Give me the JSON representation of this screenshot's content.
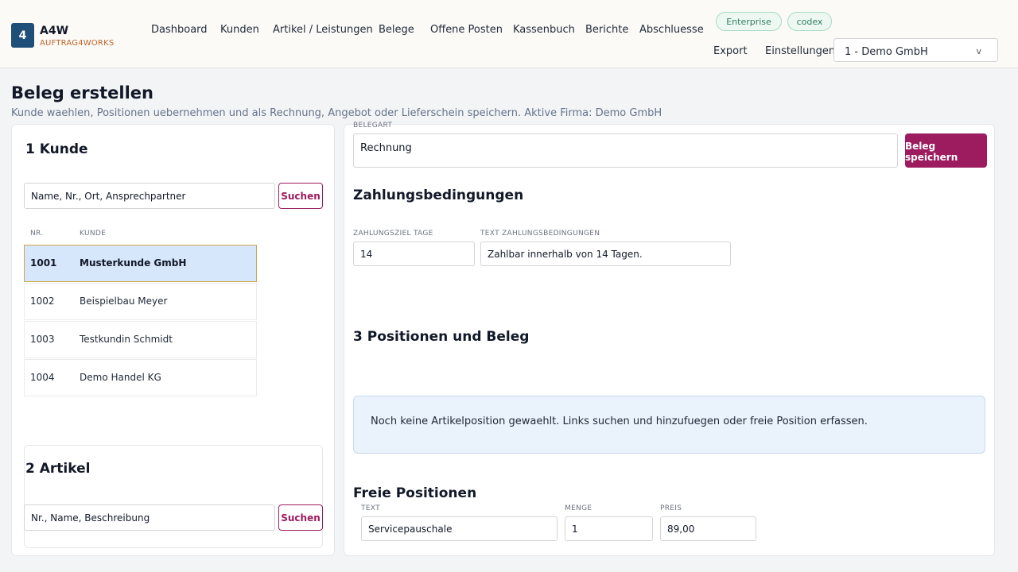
{
  "brand": {
    "logo_char": "4",
    "name": "A4W",
    "subtitle": "AUFTRAG4WORKS"
  },
  "nav": {
    "items": [
      "Dashboard",
      "Kunden",
      "Artikel / Leistungen",
      "Belege",
      "Offene Posten",
      "Kassenbuch",
      "Berichte",
      "Abschluesse"
    ],
    "badges": [
      "Enterprise",
      "codex"
    ],
    "export": "Export",
    "settings": "Einstellungen",
    "company": "1 - Demo GmbH",
    "company_chevron": "v"
  },
  "page": {
    "title": "Beleg erstellen",
    "subtitle": "Kunde waehlen, Positionen uebernehmen und als Rechnung, Angebot oder Lieferschein speichern. Aktive Firma: Demo GmbH"
  },
  "kunde": {
    "heading": "1  Kunde",
    "search_placeholder": "Name, Nr., Ort, Ansprechpartner",
    "search_button": "Suchen",
    "col_nr": "NR.",
    "col_kunde": "KUNDE",
    "rows": [
      {
        "nr": "1001",
        "name": "Musterkunde GmbH",
        "selected": true
      },
      {
        "nr": "1002",
        "name": "Beispielbau Meyer",
        "selected": false
      },
      {
        "nr": "1003",
        "name": "Testkundin Schmidt",
        "selected": false
      },
      {
        "nr": "1004",
        "name": "Demo Handel KG",
        "selected": false
      }
    ]
  },
  "artikel": {
    "heading": "2  Artikel",
    "search_placeholder": "Nr., Name, Beschreibung",
    "search_button": "Suchen"
  },
  "beleg": {
    "belegart_label": "BELEGART",
    "belegart_value": "Rechnung",
    "save_button": "Beleg speichern",
    "zahlung_heading": "Zahlungsbedingungen",
    "ziel_label": "ZAHLUNGSZIEL TAGE",
    "ziel_value": "14",
    "text_label": "TEXT ZAHLUNGSBEDINGUNGEN",
    "text_value": "Zahlbar innerhalb von 14 Tagen.",
    "positionen_heading": "3  Positionen und Beleg",
    "notice": "Noch keine Artikelposition gewaehlt. Links suchen und hinzufuegen oder freie Position erfassen.",
    "freie_heading": "Freie Positionen",
    "freie_text_label": "TEXT",
    "freie_text_value": "Servicepauschale",
    "menge_label": "MENGE",
    "menge_value": "1",
    "preis_label": "PREIS",
    "preis_value": "89,00"
  },
  "colors": {
    "accent": "#9d1b5f",
    "logo": "#1f4e79",
    "selected_row": "#d6e6fb"
  }
}
